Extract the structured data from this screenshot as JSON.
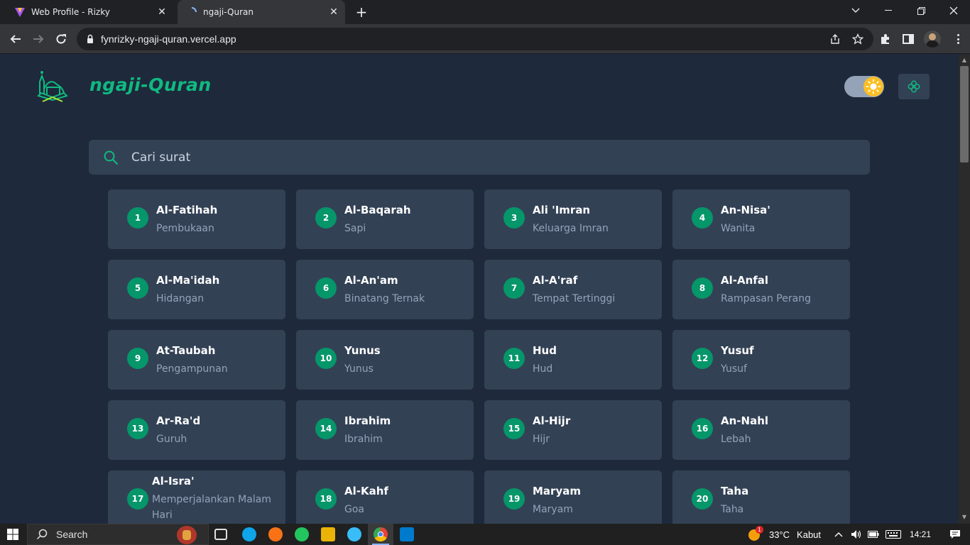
{
  "browser": {
    "tabs": [
      {
        "title": "Web Profile - Rizky",
        "active": false
      },
      {
        "title": "ngaji-Quran",
        "active": true
      }
    ],
    "url": "fynrizky-ngaji-quran.vercel.app"
  },
  "header": {
    "brand": "ngaji-Quran",
    "accent_color": "#10b981"
  },
  "search": {
    "placeholder": "Cari surat"
  },
  "surahs": [
    {
      "number": "1",
      "name": "Al-Fatihah",
      "meaning": "Pembukaan"
    },
    {
      "number": "2",
      "name": "Al-Baqarah",
      "meaning": "Sapi"
    },
    {
      "number": "3",
      "name": "Ali 'Imran",
      "meaning": "Keluarga Imran"
    },
    {
      "number": "4",
      "name": "An-Nisa'",
      "meaning": "Wanita"
    },
    {
      "number": "5",
      "name": "Al-Ma'idah",
      "meaning": "Hidangan"
    },
    {
      "number": "6",
      "name": "Al-An'am",
      "meaning": "Binatang Ternak"
    },
    {
      "number": "7",
      "name": "Al-A'raf",
      "meaning": "Tempat Tertinggi"
    },
    {
      "number": "8",
      "name": "Al-Anfal",
      "meaning": "Rampasan Perang"
    },
    {
      "number": "9",
      "name": "At-Taubah",
      "meaning": "Pengampunan"
    },
    {
      "number": "10",
      "name": "Yunus",
      "meaning": "Yunus"
    },
    {
      "number": "11",
      "name": "Hud",
      "meaning": "Hud"
    },
    {
      "number": "12",
      "name": "Yusuf",
      "meaning": "Yusuf"
    },
    {
      "number": "13",
      "name": "Ar-Ra'd",
      "meaning": "Guruh"
    },
    {
      "number": "14",
      "name": "Ibrahim",
      "meaning": "Ibrahim"
    },
    {
      "number": "15",
      "name": "Al-Hijr",
      "meaning": "Hijr"
    },
    {
      "number": "16",
      "name": "An-Nahl",
      "meaning": "Lebah"
    },
    {
      "number": "17",
      "name": "Al-Isra'",
      "meaning": "Memperjalankan Malam Hari"
    },
    {
      "number": "18",
      "name": "Al-Kahf",
      "meaning": "Goa"
    },
    {
      "number": "19",
      "name": "Maryam",
      "meaning": "Maryam"
    },
    {
      "number": "20",
      "name": "Taha",
      "meaning": "Taha"
    }
  ],
  "taskbar": {
    "search_label": "Search",
    "weather_temp": "33°C",
    "weather_desc": "Kabut",
    "time": "14:21",
    "weather_badge": "1"
  }
}
